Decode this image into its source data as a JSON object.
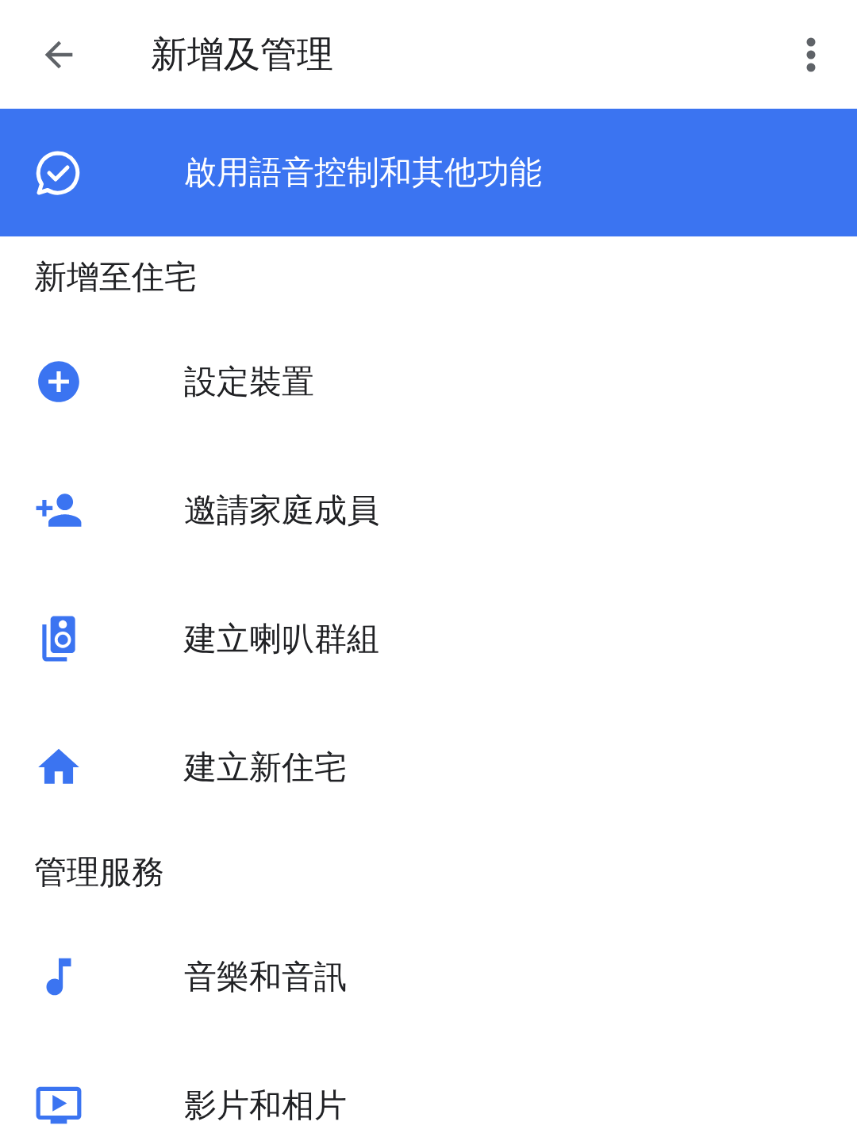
{
  "app_bar": {
    "title": "新增及管理"
  },
  "banner": {
    "label": "啟用語音控制和其他功能"
  },
  "sections": [
    {
      "heading": "新增至住宅",
      "items": [
        {
          "label": "設定裝置"
        },
        {
          "label": "邀請家庭成員"
        },
        {
          "label": "建立喇叭群組"
        },
        {
          "label": "建立新住宅"
        }
      ]
    },
    {
      "heading": "管理服務",
      "items": [
        {
          "label": "音樂和音訊"
        },
        {
          "label": "影片和相片"
        }
      ]
    }
  ]
}
